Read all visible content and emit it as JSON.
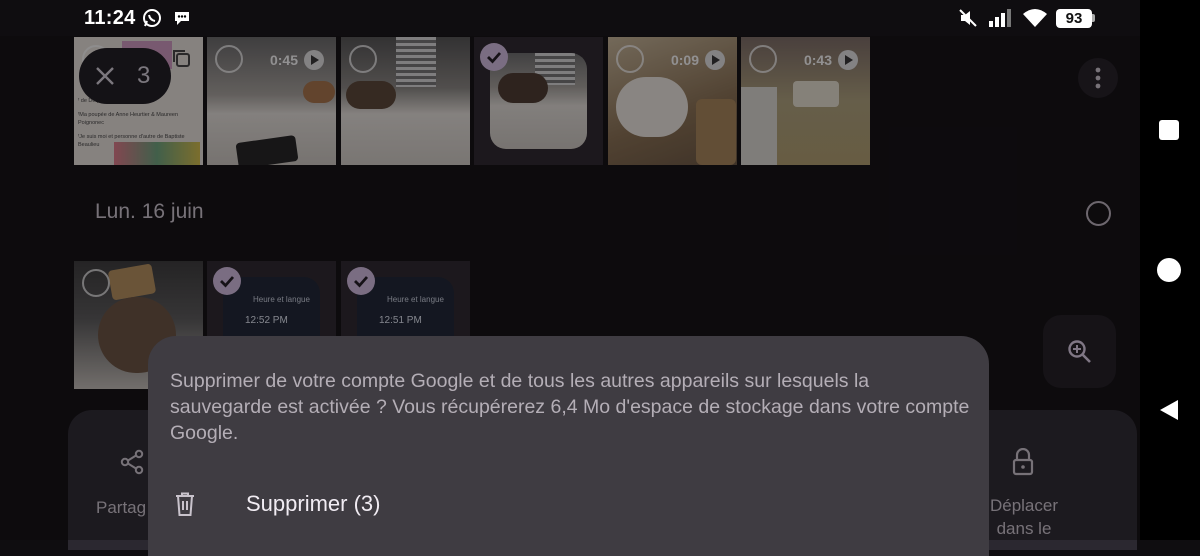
{
  "status_bar": {
    "time": "11:24",
    "battery_level": "93",
    "icons": [
      "whatsapp-icon",
      "chat-bubble-icon",
      "mute-icon",
      "signal-icon",
      "wifi-icon",
      "battery-icon"
    ]
  },
  "selection": {
    "count": "3"
  },
  "top_row_thumbs": [
    {
      "kind": "flyer",
      "selected": false
    },
    {
      "kind": "video",
      "duration": "0:45",
      "selected": false
    },
    {
      "kind": "photo",
      "selected": false
    },
    {
      "kind": "photo",
      "selected": true
    },
    {
      "kind": "video",
      "duration": "0:09",
      "selected": false
    },
    {
      "kind": "video",
      "duration": "0:43",
      "selected": false
    }
  ],
  "flyer": {
    "line1": "ᶠ de Delphine Beaulieu",
    "line2": "ᶠMa poupée de Anne Heurtier & Maureen Poignonec",
    "line3": "ᶠJe suis moi et personne d'autre de Baptiste Beaulieu"
  },
  "section": {
    "date": "Lun. 16 juin"
  },
  "bottom_row_thumbs": [
    {
      "kind": "photo",
      "selected": false
    },
    {
      "kind": "screenshot",
      "selected": true,
      "title": "Heure et langue",
      "time": "12:52 PM"
    },
    {
      "kind": "screenshot",
      "selected": true,
      "title": "Heure et langue",
      "time": "12:51 PM"
    }
  ],
  "action_bar": {
    "share_label": "Partag",
    "move_label_line1": "Déplacer",
    "move_label_line2": "dans le"
  },
  "dialog": {
    "message": "Supprimer de votre compte Google et de tous les autres appareils sur lesquels la sauvegarde est activée ? Vous récupérerez 6,4 Mo d'espace de stockage dans votre compte Google.",
    "delete_label": "Supprimer (3)"
  },
  "colors": {
    "accent": "#d6bfe3",
    "sheet": "#3f3c42",
    "background": "#0f0d10"
  }
}
